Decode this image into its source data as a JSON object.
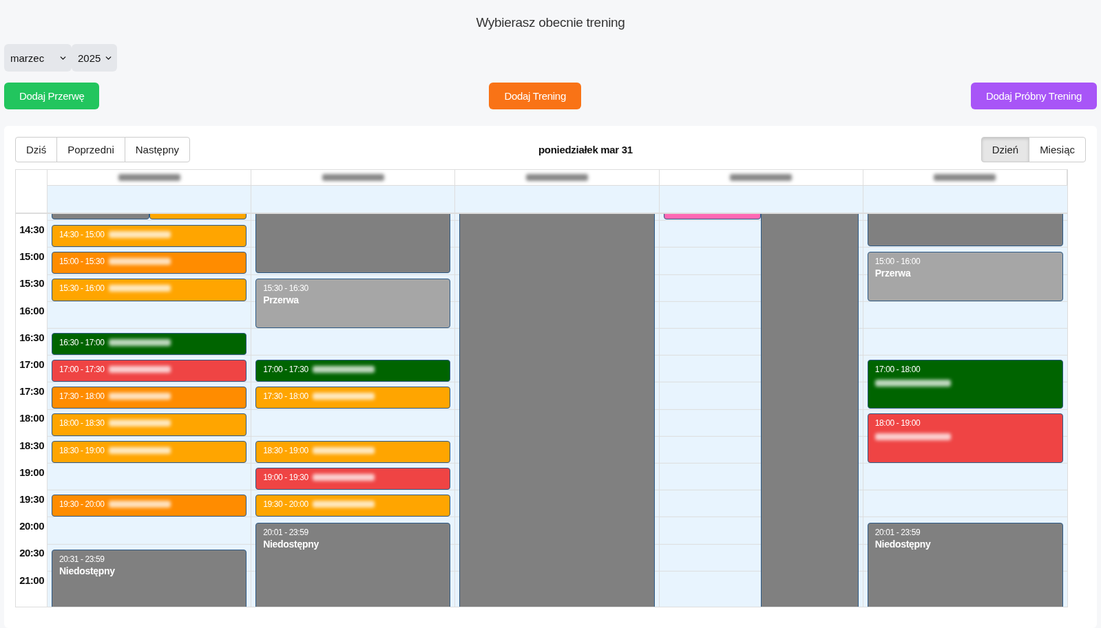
{
  "heading": "Wybierasz obecnie trening",
  "selects": [
    {
      "kind": "month",
      "value": "marzec"
    },
    {
      "kind": "year",
      "value": "2025"
    }
  ],
  "actions": [
    {
      "label": "Dodaj Przerwę",
      "color": "#22c55e"
    },
    {
      "label": "Dodaj Trening",
      "color": "#f97316"
    },
    {
      "label": "Dodaj Próbny Trening",
      "color": "#a855f7"
    }
  ],
  "calendar": {
    "nav": [
      {
        "label": "Dziś"
      },
      {
        "label": "Poprzedni"
      },
      {
        "label": "Następny"
      }
    ],
    "date_title": "poniedziałek mar 31",
    "views": [
      {
        "label": "Dzień",
        "selected": true
      },
      {
        "label": "Miesiąc",
        "selected": false
      }
    ],
    "time_labels": [
      "14:30",
      "15:00",
      "15:30",
      "16:00",
      "16:30",
      "17:00",
      "17:30",
      "18:00",
      "18:30",
      "19:00",
      "19:30",
      "20:00",
      "20:30",
      "21:00"
    ],
    "columns": [
      {
        "header_blurred": true,
        "blocks": [
          {
            "kind": "cut",
            "left_half": true,
            "right_half": false,
            "color": "#808080"
          },
          {
            "kind": "cut",
            "left_half": false,
            "right_half": true,
            "color": "#ffa500"
          },
          {
            "kind": "event",
            "time": "14:30 - 15:00",
            "name_blurred": true,
            "color": "#ffa500"
          },
          {
            "kind": "event",
            "time": "15:00 - 15:30",
            "name_blurred": true,
            "color": "#ff8c00"
          },
          {
            "kind": "event",
            "time": "15:30 - 16:00",
            "name_blurred": true,
            "color": "#ffa500"
          },
          {
            "kind": "event",
            "time": "16:30 - 17:00",
            "name_blurred": true,
            "color": "#006400"
          },
          {
            "kind": "event",
            "time": "17:00 - 17:30",
            "name_blurred": true,
            "color": "#ef4444"
          },
          {
            "kind": "event",
            "time": "17:30 - 18:00",
            "name_blurred": true,
            "color": "#ff8c00"
          },
          {
            "kind": "event",
            "time": "18:00 - 18:30",
            "name_blurred": true,
            "color": "#ffa500"
          },
          {
            "kind": "event",
            "time": "18:30 - 19:00",
            "name_blurred": true,
            "color": "#ffa500"
          },
          {
            "kind": "event",
            "time": "19:30 - 20:00",
            "name_blurred": true,
            "color": "#ff8c00"
          },
          {
            "kind": "event",
            "time": "20:31 - 23:59",
            "title": "Niedostępny",
            "color": "#808080"
          }
        ]
      },
      {
        "header_blurred": true,
        "blocks": [
          {
            "kind": "cut",
            "color": "#808080"
          },
          {
            "kind": "event",
            "time": "15:30 - 16:30",
            "title": "Przerwa",
            "color": "#a6a6a6"
          },
          {
            "kind": "event",
            "time": "17:00 - 17:30",
            "name_blurred": true,
            "color": "#006400"
          },
          {
            "kind": "event",
            "time": "17:30 - 18:00",
            "name_blurred": true,
            "color": "#ffa500"
          },
          {
            "kind": "event",
            "time": "18:30 - 19:00",
            "name_blurred": true,
            "color": "#ffa500"
          },
          {
            "kind": "event",
            "time": "19:00 - 19:30",
            "name_blurred": true,
            "color": "#ef4444"
          },
          {
            "kind": "event",
            "time": "19:30 - 20:00",
            "name_blurred": true,
            "color": "#ffa500"
          },
          {
            "kind": "event",
            "time": "20:01 - 23:59",
            "title": "Niedostępny",
            "color": "#808080"
          }
        ]
      },
      {
        "header_blurred": true,
        "blocks": [
          {
            "kind": "full",
            "color": "#808080"
          }
        ]
      },
      {
        "header_blurred": true,
        "blocks": [
          {
            "kind": "cut",
            "left_half": true,
            "right_half": false,
            "color": "#ff69b4"
          },
          {
            "kind": "full",
            "left_half": false,
            "right_half": true,
            "color": "#808080"
          }
        ]
      },
      {
        "header_blurred": true,
        "blocks": [
          {
            "kind": "cut",
            "color": "#808080"
          },
          {
            "kind": "event",
            "time": "15:00 - 16:00",
            "title": "Przerwa",
            "color": "#a6a6a6"
          },
          {
            "kind": "event",
            "time": "17:00 - 18:00",
            "name_blurred": true,
            "color": "#006400"
          },
          {
            "kind": "event",
            "time": "18:00 - 19:00",
            "name_blurred": true,
            "color": "#ef4444"
          },
          {
            "kind": "event",
            "time": "20:01 - 23:59",
            "title": "Niedostępny",
            "color": "#808080"
          }
        ]
      }
    ]
  }
}
